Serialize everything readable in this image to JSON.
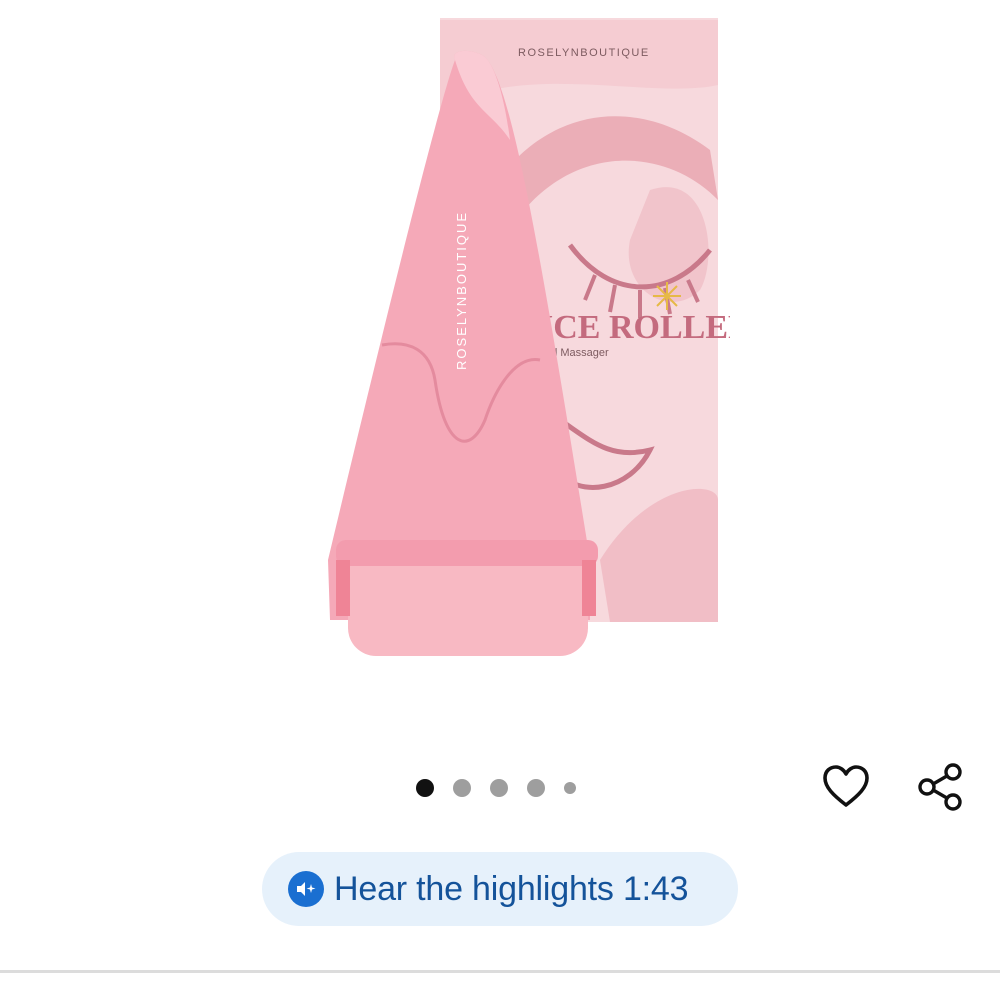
{
  "product_image": {
    "box_brand": "ROSELYNBOUTIQUE",
    "box_title": "ICE ROLLER",
    "box_subtitle": "Facial Massager",
    "roller_brand": "ROSELYNBOUTIQUE"
  },
  "carousel": {
    "total": 5,
    "active_index": 0
  },
  "actions": {
    "favorite_icon": "heart-outline-icon",
    "share_icon": "share-icon"
  },
  "highlights": {
    "icon": "audio-sparkle-icon",
    "label": "Hear the highlights 1:43"
  },
  "colors": {
    "accent_blue": "#1a6fd1",
    "pill_bg": "#e6f1fb",
    "pill_text": "#14539a",
    "roller_pink": "#f4a8b6",
    "box_pink": "#f6d3d8"
  }
}
